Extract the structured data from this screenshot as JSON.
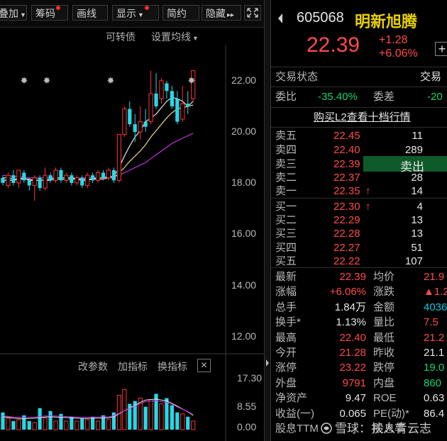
{
  "toolbar": {
    "items": [
      {
        "label": "叠加",
        "caret": true,
        "dot": false
      },
      {
        "label": "筹码",
        "caret": false,
        "dot": true
      },
      {
        "label": "画线",
        "caret": false,
        "dot": false
      },
      {
        "label": "显示",
        "caret": true,
        "dot": true
      },
      {
        "label": "简约",
        "caret": false,
        "dot": false
      },
      {
        "label": "隐藏",
        "caret": false,
        "dot": false
      }
    ],
    "hide_arrows": "▸▸",
    "fullscreen_icon": "fullscreen-icon"
  },
  "chart_header": {
    "convertible": "可转债",
    "ma_settings": "设置均线"
  },
  "indicator_bar": {
    "change_params": "改参数",
    "add_indicator": "加指标",
    "switch_indicator": "换指标",
    "close": "✕"
  },
  "chart_data": {
    "type": "candlestick",
    "price_ticks": [
      "22.00",
      "20.00",
      "18.00",
      "16.00",
      "14.00",
      "12.00"
    ],
    "price_ylim": [
      11.5,
      23.5
    ],
    "volume_ticks": [
      "17.30",
      "8.55",
      "0.00"
    ],
    "volume_ylim": [
      0,
      17.3
    ],
    "candles": [
      {
        "o": 18.2,
        "c": 18.0,
        "h": 18.3,
        "l": 17.9
      },
      {
        "o": 17.9,
        "c": 18.3,
        "h": 18.4,
        "l": 17.8
      },
      {
        "o": 18.3,
        "c": 18.0,
        "h": 18.5,
        "l": 17.9
      },
      {
        "o": 18.0,
        "c": 18.5,
        "h": 18.5,
        "l": 17.8
      },
      {
        "o": 18.4,
        "c": 18.1,
        "h": 18.5,
        "l": 18.0
      },
      {
        "o": 18.1,
        "c": 17.9,
        "h": 18.2,
        "l": 17.7
      },
      {
        "o": 17.9,
        "c": 18.2,
        "h": 18.3,
        "l": 17.3
      },
      {
        "o": 18.2,
        "c": 17.8,
        "h": 18.3,
        "l": 17.7
      },
      {
        "o": 17.8,
        "c": 18.3,
        "h": 18.6,
        "l": 17.7
      },
      {
        "o": 18.3,
        "c": 18.1,
        "h": 18.4,
        "l": 18.0
      },
      {
        "o": 18.1,
        "c": 18.5,
        "h": 18.6,
        "l": 18.0
      },
      {
        "o": 18.5,
        "c": 18.1,
        "h": 18.6,
        "l": 18.0
      },
      {
        "o": 18.1,
        "c": 18.3,
        "h": 18.4,
        "l": 18.0
      },
      {
        "o": 18.3,
        "c": 18.0,
        "h": 18.4,
        "l": 17.9
      },
      {
        "o": 18.0,
        "c": 18.2,
        "h": 18.3,
        "l": 17.9
      },
      {
        "o": 18.2,
        "c": 17.9,
        "h": 18.3,
        "l": 17.8
      },
      {
        "o": 17.9,
        "c": 18.3,
        "h": 18.4,
        "l": 17.8
      },
      {
        "o": 18.3,
        "c": 18.1,
        "h": 18.4,
        "l": 18.0
      },
      {
        "o": 18.1,
        "c": 18.4,
        "h": 18.5,
        "l": 18.0
      },
      {
        "o": 18.4,
        "c": 18.2,
        "h": 18.5,
        "l": 18.1
      },
      {
        "o": 18.2,
        "c": 18.5,
        "h": 18.6,
        "l": 18.1
      },
      {
        "o": 18.5,
        "c": 18.1,
        "h": 18.6,
        "l": 18.0
      },
      {
        "o": 18.1,
        "c": 19.9,
        "h": 19.9,
        "l": 18.0
      },
      {
        "o": 19.9,
        "c": 20.9,
        "h": 21.0,
        "l": 19.8
      },
      {
        "o": 20.9,
        "c": 20.3,
        "h": 21.2,
        "l": 20.2
      },
      {
        "o": 20.3,
        "c": 20.0,
        "h": 20.7,
        "l": 19.6
      },
      {
        "o": 20.0,
        "c": 20.4,
        "h": 21.0,
        "l": 19.7
      },
      {
        "o": 20.4,
        "c": 20.2,
        "h": 20.9,
        "l": 20.0
      },
      {
        "o": 20.4,
        "c": 21.5,
        "h": 22.4,
        "l": 20.3
      },
      {
        "o": 21.5,
        "c": 21.0,
        "h": 22.3,
        "l": 20.9
      },
      {
        "o": 21.3,
        "c": 22.0,
        "h": 22.1,
        "l": 21.1
      },
      {
        "o": 21.9,
        "c": 21.6,
        "h": 22.0,
        "l": 21.3
      },
      {
        "o": 21.6,
        "c": 21.0,
        "h": 21.8,
        "l": 20.9
      },
      {
        "o": 21.3,
        "c": 20.4,
        "h": 21.6,
        "l": 20.3
      },
      {
        "o": 20.5,
        "c": 21.1,
        "h": 21.8,
        "l": 20.4
      },
      {
        "o": 21.1,
        "c": 21.0,
        "h": 21.6,
        "l": 20.7
      },
      {
        "o": 21.3,
        "c": 22.4,
        "h": 22.4,
        "l": 21.2
      }
    ],
    "volumes": [
      6.0,
      4.0,
      3.0,
      3.5,
      5.0,
      3.0,
      2.5,
      7.5,
      4.0,
      6.5,
      3.0,
      5.5,
      3.0,
      4.5,
      3.0,
      4.0,
      3.5,
      4.5,
      3.0,
      5.0,
      3.5,
      6.0,
      12.0,
      14.0,
      9.0,
      10.0,
      11.0,
      8.0,
      10.5,
      12.5,
      9.0,
      11.0,
      8.5,
      6.0,
      5.5,
      4.5,
      3.0
    ],
    "ma5": [
      18.1,
      18.1,
      18.1,
      18.15,
      18.2,
      18.1,
      18.1,
      18.1,
      18.1,
      18.15,
      18.2,
      18.2,
      18.2,
      18.2,
      18.15,
      18.1,
      18.1,
      18.15,
      18.2,
      18.2,
      18.25,
      18.25,
      18.6,
      19.05,
      19.45,
      19.8,
      20.05,
      20.4,
      20.55,
      20.7,
      20.95,
      21.2,
      21.35,
      21.3,
      21.2,
      21.0,
      21.2
    ],
    "ma10": [
      18.2,
      18.2,
      18.15,
      18.15,
      18.15,
      18.15,
      18.1,
      18.1,
      18.1,
      18.1,
      18.15,
      18.15,
      18.15,
      18.15,
      18.15,
      18.15,
      18.15,
      18.15,
      18.15,
      18.15,
      18.2,
      18.2,
      18.4,
      18.6,
      18.85,
      19.05,
      19.25,
      19.5,
      19.8,
      20.05,
      20.3,
      20.55,
      20.75,
      20.9,
      20.95,
      21.0,
      21.05
    ],
    "ma20": [
      18.3,
      18.28,
      18.26,
      18.24,
      18.22,
      18.2,
      18.2,
      18.2,
      18.2,
      18.2,
      18.2,
      18.2,
      18.2,
      18.2,
      18.2,
      18.2,
      18.2,
      18.2,
      18.2,
      18.2,
      18.22,
      18.24,
      18.3,
      18.4,
      18.5,
      18.6,
      18.7,
      18.8,
      18.95,
      19.1,
      19.25,
      19.4,
      19.55,
      19.65,
      19.75,
      19.85,
      19.95
    ],
    "vol_ma": [
      4.5,
      4.3,
      4.0,
      3.9,
      3.8,
      3.9,
      4.0,
      4.2,
      4.4,
      4.5,
      4.4,
      4.3,
      4.2,
      4.1,
      4.0,
      3.9,
      3.9,
      4.0,
      4.0,
      4.1,
      4.1,
      4.5,
      5.5,
      6.6,
      7.5,
      8.5,
      9.5,
      10.3,
      10.5,
      10.7,
      10.3,
      10.0,
      9.2,
      8.2,
      7.2,
      6.2,
      5.0
    ],
    "star_markers": [
      1,
      3,
      10,
      17
    ]
  },
  "quote": {
    "code": "605068",
    "name": "明新旭腾",
    "price": "22.39",
    "change": "+1.28",
    "change_pct": "+6.06%",
    "plus": "+"
  },
  "trade_status": {
    "label": "交易状态",
    "value": "交易"
  },
  "committee": {
    "ratio_label": "委比",
    "ratio_value": "-35.40%",
    "diff_label": "委差",
    "diff_value": "-20"
  },
  "l2_link": "购买L2查看十档行情",
  "sell_button": "卖出",
  "asks": [
    {
      "label": "卖五",
      "price": "22.45",
      "vol": "11"
    },
    {
      "label": "卖四",
      "price": "22.40",
      "vol": "289"
    },
    {
      "label": "卖三",
      "price": "22.39",
      "vol": ""
    },
    {
      "label": "卖二",
      "price": "22.37",
      "vol": "28"
    },
    {
      "label": "卖一",
      "price": "22.35",
      "vol": "14",
      "arrow": "↑"
    }
  ],
  "bids": [
    {
      "label": "买一",
      "price": "22.30",
      "vol": "4",
      "arrow": "↑"
    },
    {
      "label": "买二",
      "price": "22.29",
      "vol": "13"
    },
    {
      "label": "买三",
      "price": "22.28",
      "vol": "13"
    },
    {
      "label": "买四",
      "price": "22.27",
      "vol": "51"
    },
    {
      "label": "买五",
      "price": "22.22",
      "vol": "107"
    }
  ],
  "stats": [
    {
      "l1": "最新",
      "v1": "22.39",
      "c1": "red",
      "l2": "均价",
      "v2": "21.9",
      "c2": "red"
    },
    {
      "l1": "涨幅",
      "v1": "+6.06%",
      "c1": "red",
      "l2": "涨跌",
      "v2": "▲1.2",
      "c2": "red"
    },
    {
      "l1": "总手",
      "v1": "1.84万",
      "c1": "white",
      "l2": "金额",
      "v2": "4036",
      "c2": "cyan"
    },
    {
      "l1": "换手*",
      "v1": "1.13%",
      "c1": "white",
      "l2": "量比",
      "v2": "7.5",
      "c2": "red"
    },
    {
      "l1": "最高",
      "v1": "22.40",
      "c1": "red",
      "l2": "最低",
      "v2": "21.2",
      "c2": "red"
    },
    {
      "l1": "今开",
      "v1": "21.28",
      "c1": "red",
      "l2": "昨收",
      "v2": "21.1",
      "c2": "white"
    },
    {
      "l1": "涨停",
      "v1": "23.22",
      "c1": "red",
      "l2": "跌停",
      "v2": "19.0",
      "c2": "green"
    },
    {
      "l1": "外盘",
      "v1": "9791",
      "c1": "red",
      "l2": "内盘",
      "v2": "860",
      "c2": "green"
    },
    {
      "l1": "净资产",
      "v1": "9.47",
      "c1": "white",
      "l2": "ROE",
      "v2": "0.63",
      "c2": "white"
    },
    {
      "l1": "收益(一)",
      "v1": "0.065",
      "c1": "white",
      "l2": "PE(动)*",
      "v2": "86.4",
      "c2": "white"
    },
    {
      "l1": "股息TTM",
      "v1": "",
      "c1": "white",
      "l2": "股息率",
      "v2": "",
      "c2": "white"
    }
  ],
  "watermark": "雪球：扶人青云志"
}
